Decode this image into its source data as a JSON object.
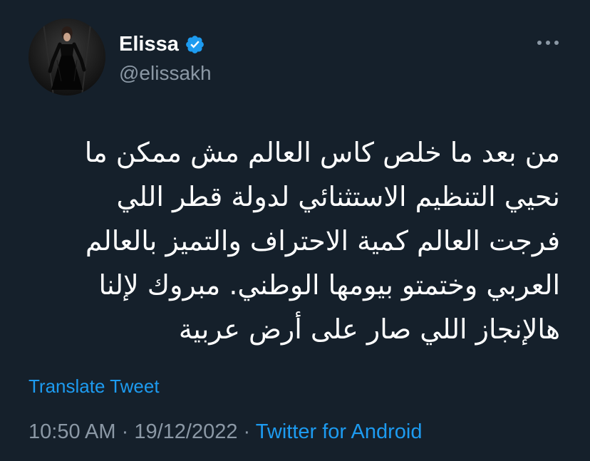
{
  "author": {
    "display_name": "Elissa",
    "handle": "@elissakh",
    "verified": true,
    "avatar_icon": "profile-photo"
  },
  "tweet": {
    "text": "من بعد ما خلص كاس العالم مش ممكن ما\nنحيي التنظيم الاستثنائي لدولة قطر اللي\nفرجت العالم كمية الاحتراف والتميز بالعالم\nالعربي وختمتو بيومها الوطني. مبروك لإلنا\nهالإنجاز اللي صار على أرض عربية",
    "translate_label": "Translate Tweet"
  },
  "meta": {
    "time": "10:50 AM",
    "separator": "·",
    "date": "19/12/2022",
    "source": "Twitter for Android"
  },
  "colors": {
    "background": "#15202b",
    "accent": "#1d9bf0",
    "secondary_text": "#8b98a5"
  }
}
